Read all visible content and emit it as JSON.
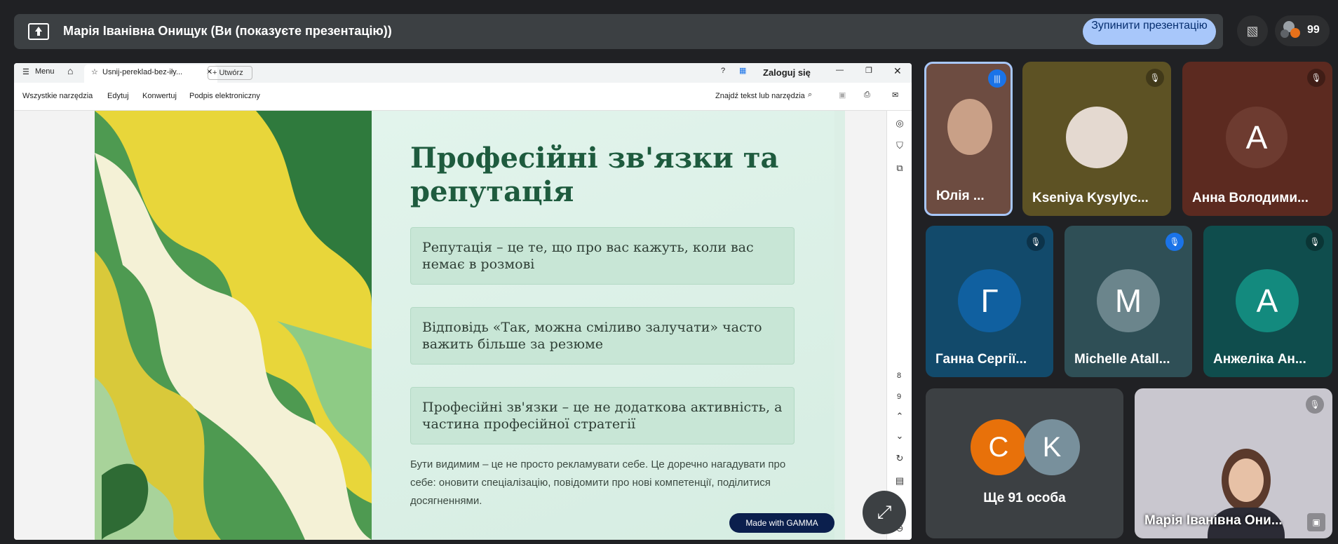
{
  "presentation_bar": {
    "title": "Марія Іванівна Онищук (Ви (показуєте презентацію))",
    "stop_button": "Зупинити презентацію",
    "people_count": "99"
  },
  "browser": {
    "menu": "Menu",
    "tab_title": "Usnij-pereklad-bez-iły...",
    "new_tab": "Utwórz",
    "login": "Zaloguj się",
    "toolbar": [
      "Wszystkie narzędzia",
      "Edytuj",
      "Konwertuj",
      "Podpis elektroniczny"
    ],
    "search_tools": "Znajdź tekst lub narzędzia",
    "pages": [
      "8",
      "9"
    ]
  },
  "slide": {
    "title": "Професійні зв'язки та репутація",
    "cards": [
      "Репутація – це те, що про вас кажуть, коли вас немає в розмові",
      "Відповідь «Так, можна сміливо залучати» часто важить більше за резюме",
      "Професійні зв'язки – це не додаткова активність, а частина професійної стратегії"
    ],
    "body": "Бути видимим – це не просто рекламувати себе. Це доречно нагадувати про себе: оновити спеціалізацію, повідомити про нові компетенції, поділитися досягненнями.",
    "badge": "Made with GAMMA"
  },
  "participants": [
    {
      "name": "Юлія ...",
      "letter": "",
      "color": "#6d4c41"
    },
    {
      "name": "Kseniya Kysylyc...",
      "letter": "",
      "color": "#5d5224"
    },
    {
      "name": "Анна Володими...",
      "letter": "А",
      "color": "#5c2a20"
    },
    {
      "name": "Ганна Сергії...",
      "letter": "Г",
      "color": "#124a6b"
    },
    {
      "name": "Michelle Atall...",
      "letter": "M",
      "color": "#2f4f56"
    },
    {
      "name": "Анжеліка Ан...",
      "letter": "А",
      "color": "#0f4d4d"
    },
    {
      "name": "Ще 91 особа",
      "letter": "",
      "color": "#3c4043"
    },
    {
      "name": "Марія Іванівна Они...",
      "letter": "",
      "color": "#c9c7cf"
    }
  ],
  "more_avatars": [
    "C",
    "K"
  ]
}
